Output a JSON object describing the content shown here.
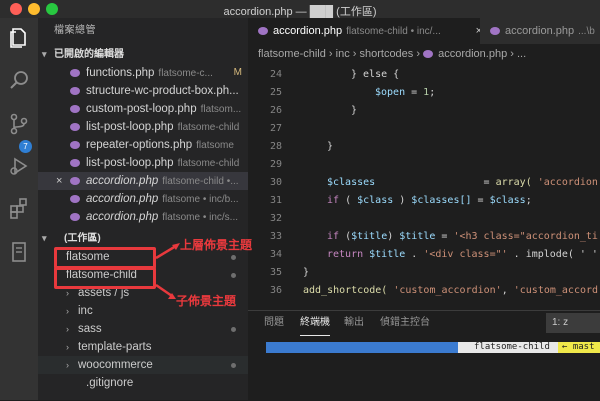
{
  "window": {
    "title": "accordion.php — ███ (工作區)"
  },
  "explorer": {
    "header": "檔案總管",
    "open_editors_label": "已開啟的編輯器",
    "open_editors": [
      {
        "name": "functions.php",
        "path": "flatsome-c...",
        "mark": "M"
      },
      {
        "name": "structure-wc-product-box.ph...",
        "path": ""
      },
      {
        "name": "custom-post-loop.php",
        "path": "flatsom..."
      },
      {
        "name": "list-post-loop.php",
        "path": "flatsome-child"
      },
      {
        "name": "repeater-options.php",
        "path": "flatsome"
      },
      {
        "name": "list-post-loop.php",
        "path": "flatsome-child"
      },
      {
        "name": "accordion.php",
        "path": "flatsome-child •..."
      },
      {
        "name": "accordion.php",
        "path": "flatsome • inc/b..."
      },
      {
        "name": "accordion.php",
        "path": "flatsome • inc/s..."
      }
    ],
    "workspace_label": "(工作區)",
    "folders": [
      {
        "name": "flatsome"
      },
      {
        "name": "flatsome-child"
      },
      {
        "name": "assets / js"
      },
      {
        "name": "inc"
      },
      {
        "name": "sass"
      },
      {
        "name": "template-parts"
      },
      {
        "name": "woocommerce"
      },
      {
        "name": ".gitignore"
      }
    ]
  },
  "editor": {
    "tabs": [
      {
        "name": "accordion.php",
        "sub": "flatsome-child • inc/..."
      },
      {
        "name": "accordion.php",
        "sub": "...\\b"
      }
    ],
    "breadcrumb": [
      "flatsome-child",
      "inc",
      "shortcodes",
      "accordion.php",
      "..."
    ],
    "line_numbers": [
      "24",
      "25",
      "26",
      "27",
      "28",
      "29",
      "30",
      "31",
      "32",
      "33",
      "34",
      "35",
      "36"
    ],
    "code": {
      "l24_a": "} else {",
      "l25_var": "$open",
      "l25_eq": " = ",
      "l25_num": "1",
      "l25_end": ";",
      "l26": "}",
      "l28": "}",
      "l30_var": "$classes",
      "l30_eq": "                  = ",
      "l30_fn": "array(",
      "l30_str": " 'accordion'",
      "l31_kw": "if",
      "l31_a": " ( ",
      "l31_var": "$class",
      "l31_b": " ) ",
      "l31_var2": "$classes[]",
      "l31_c": " = ",
      "l31_var3": "$class",
      "l31_d": ";",
      "l33_kw": "if",
      "l33_a": " (",
      "l33_var": "$title",
      "l33_b": ") ",
      "l33_var2": "$title",
      "l33_c": " = ",
      "l33_str": "'<h3 class=\"accordion_ti",
      "l34_kw": "return",
      "l34_var": " $title",
      "l34_a": " . ",
      "l34_str": "'<div class=\"'",
      "l34_b": " . implode( ' '",
      "l35": "}",
      "l36_fn": "add_shortcode(",
      "l36_str": " 'custom_accordion'",
      "l36_a": ", ",
      "l36_str2": "'custom_accord"
    }
  },
  "panel": {
    "tabs": [
      "問題",
      "終端機",
      "輸出",
      "偵錯主控台"
    ],
    "terminal_selector": "1: z",
    "prompt_branch_dir": "flatsome-child",
    "prompt_git": "← mast"
  },
  "annotations": {
    "parent_theme": "上層佈景主題",
    "child_theme": "子佈景主題"
  },
  "colors": {
    "annotation": "#e8393d",
    "php_icon": "#a074c4",
    "accent_blue": "#2f7fd4"
  }
}
